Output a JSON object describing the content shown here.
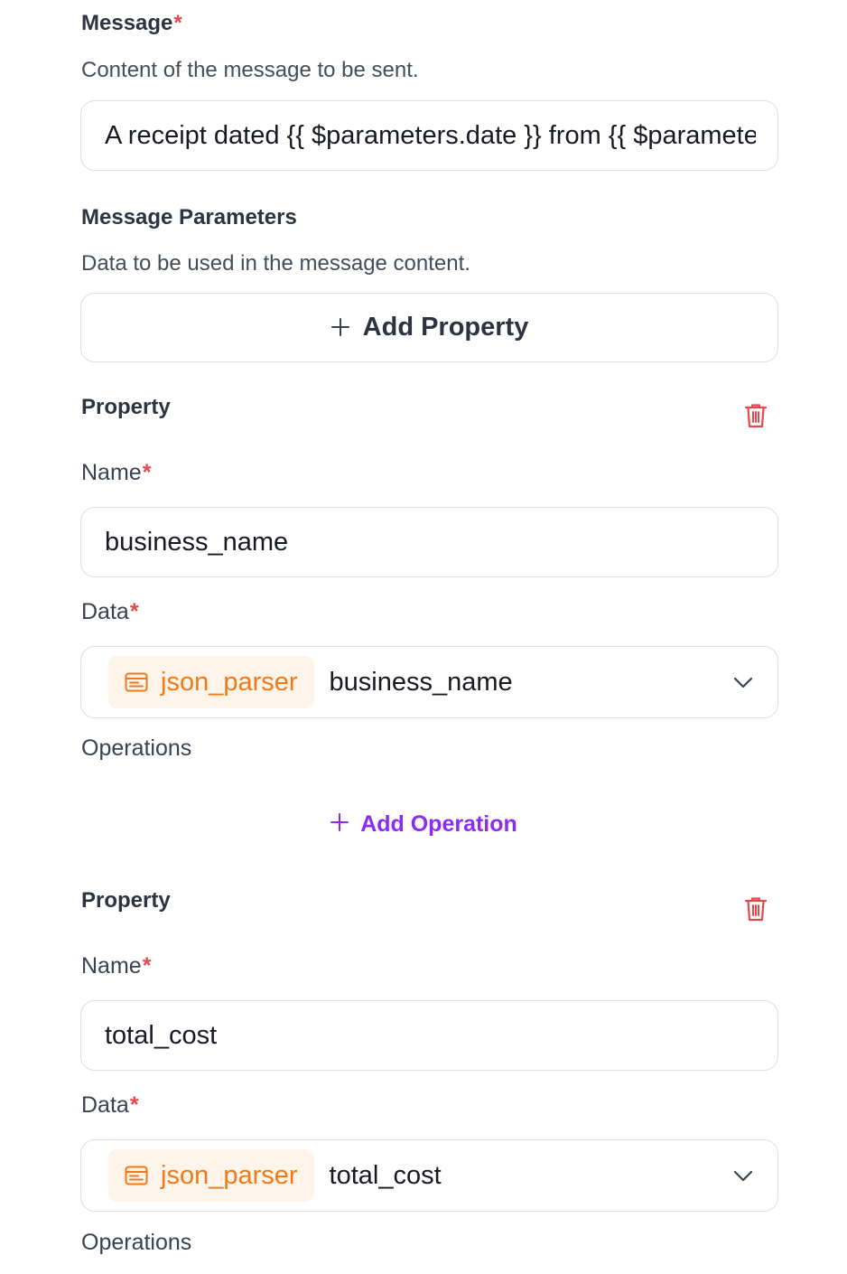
{
  "message": {
    "label": "Message",
    "required_mark": "*",
    "description": "Content of the message to be sent.",
    "value": "A receipt dated {{ $parameters.date }} from {{ $parameters.business_name }}"
  },
  "message_parameters": {
    "label": "Message Parameters",
    "description": "Data to be used in the message content.",
    "add_property_label": "Add Property",
    "add_property_icon": "plus-icon"
  },
  "properties": [
    {
      "title": "Property",
      "delete_icon": "trash-icon",
      "name_label": "Name",
      "name_value": "business_name",
      "data_label": "Data",
      "data_source": "json_parser",
      "data_source_icon": "json-parser-icon",
      "data_value": "business_name",
      "operations_label": "Operations",
      "add_operation_label": "Add Operation"
    },
    {
      "title": "Property",
      "delete_icon": "trash-icon",
      "name_label": "Name",
      "name_value": "total_cost",
      "data_label": "Data",
      "data_source": "json_parser",
      "data_source_icon": "json-parser-icon",
      "data_value": "total_cost",
      "operations_label": "Operations"
    }
  ],
  "colors": {
    "required": "#e5484d",
    "delete": "#e5484d",
    "chip_text": "#f07a1a",
    "chip_bg": "#fff4ea",
    "accent": "#8b2cf5",
    "border": "#dcdfe5"
  }
}
